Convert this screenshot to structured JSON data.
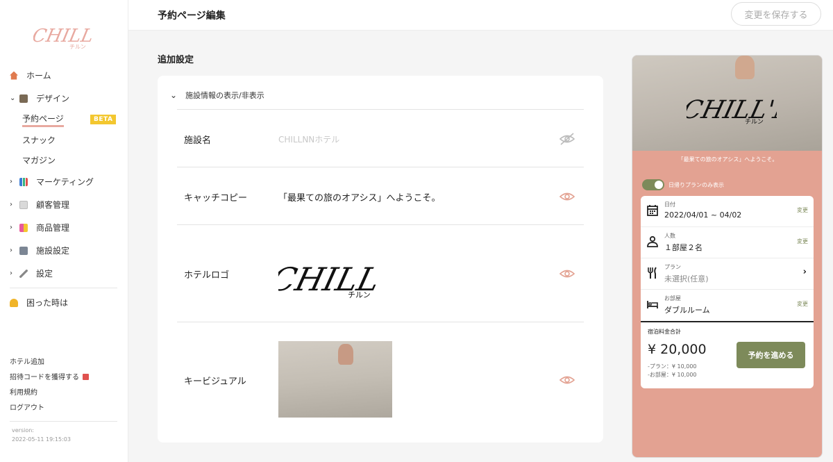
{
  "sidebar": {
    "nav": [
      {
        "label": "ホーム",
        "icon": "house-icon"
      },
      {
        "label": "デザイン",
        "icon": "design-icon"
      },
      {
        "label": "マーケティング",
        "icon": "chart-icon"
      },
      {
        "label": "顧客管理",
        "icon": "document-icon"
      },
      {
        "label": "商品管理",
        "icon": "shopping-bag-icon"
      },
      {
        "label": "施設設定",
        "icon": "building-icon"
      },
      {
        "label": "設定",
        "icon": "wrench-icon"
      },
      {
        "label": "困った時は",
        "icon": "help-person-icon"
      }
    ],
    "design_sub": [
      {
        "label": "予約ページ"
      },
      {
        "label": "スナック"
      },
      {
        "label": "マガジン"
      }
    ],
    "beta_badge": "BETA",
    "footer": {
      "add_hotel": "ホテル追加",
      "invite_code": "招待コードを獲得する",
      "terms": "利用規約",
      "logout": "ログアウト"
    },
    "version_label": "version:",
    "version_value": "2022-05-11 19:15:03"
  },
  "header": {
    "title": "予約ページ編集",
    "save_button": "変更を保存する"
  },
  "main": {
    "section_title": "追加設定",
    "toggle_label": "施設情報の表示/非表示",
    "rows": [
      {
        "label": "施設名",
        "placeholder": "CHILLNNホテル"
      },
      {
        "label": "キャッチコピー",
        "value": "「最果ての旅のオアシス」へようこそ。"
      },
      {
        "label": "ホテルロゴ"
      },
      {
        "label": "キービジュアル"
      }
    ],
    "logo_text": "CHILL'NN"
  },
  "preview": {
    "welcome": "「最果ての旅のオアシス」へようこそ。",
    "daytrip_label": "日帰りプランのみ表示",
    "date": {
      "label": "日付",
      "value": "2022/04/01 ~ 04/02",
      "change": "変更"
    },
    "guests": {
      "label": "人数",
      "value": "１部屋２名",
      "change": "変更"
    },
    "plan": {
      "label": "プラン",
      "value": "未選択(任意)"
    },
    "room": {
      "label": "お部屋",
      "value": "ダブルルーム",
      "change": "変更"
    },
    "total_label": "宿泊料金合計",
    "total_price": "¥ 20,000",
    "plan_breakdown": "-プラン：¥ 10,000",
    "room_breakdown": "-お部屋：¥ 10,000",
    "reserve_button": "予約を進める"
  },
  "colors": {
    "accent_pink": "#e3a292",
    "olive": "#7d8a5a",
    "beta_yellow": "#f3c72f"
  }
}
